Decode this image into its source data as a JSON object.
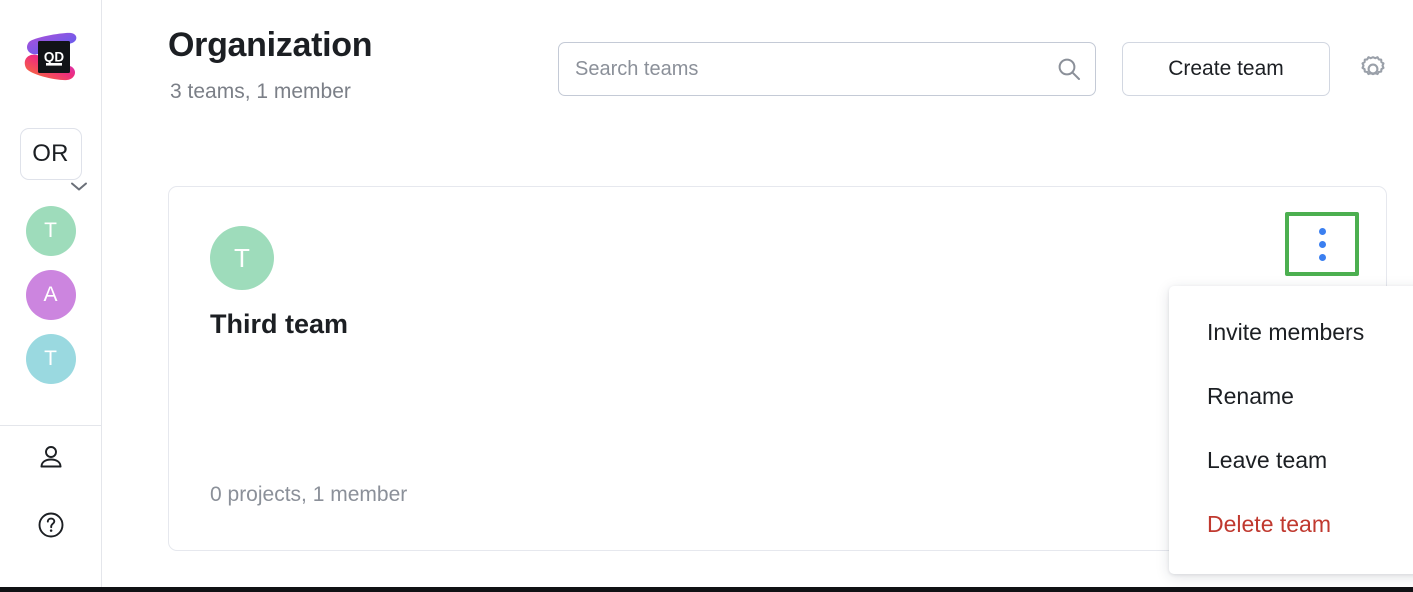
{
  "sidebar": {
    "logo": {
      "name": "qodana-logo",
      "text": "QD"
    },
    "org_switcher": {
      "label": "OR",
      "chevron": "chevron-down-icon"
    },
    "avatars": [
      {
        "initial": "T",
        "color": "#9edcbb"
      },
      {
        "initial": "A",
        "color": "#cc85df"
      },
      {
        "initial": "T",
        "color": "#9ad9e0"
      }
    ],
    "bottom_icons": [
      {
        "name": "person-icon"
      },
      {
        "name": "help-circle-icon"
      }
    ]
  },
  "header": {
    "title": "Organization",
    "subtitle": "3 teams, 1 member",
    "search": {
      "placeholder": "Search teams",
      "value": "",
      "icon": "search-icon"
    },
    "create_team_label": "Create team",
    "settings_icon": "gear-icon"
  },
  "team_card": {
    "avatar_initial": "T",
    "avatar_color": "#9edcbb",
    "name": "Third team",
    "meta": "0 projects, 1 member",
    "kebab_icon": "more-vertical-icon",
    "highlight_color": "#4caf50",
    "dot_color": "#3b7ff0"
  },
  "context_menu": {
    "items": [
      {
        "label": "Invite members",
        "danger": false
      },
      {
        "label": "Rename",
        "danger": false
      },
      {
        "label": "Leave team",
        "danger": false
      },
      {
        "label": "Delete team",
        "danger": true
      }
    ],
    "danger_color": "#c0392f"
  }
}
